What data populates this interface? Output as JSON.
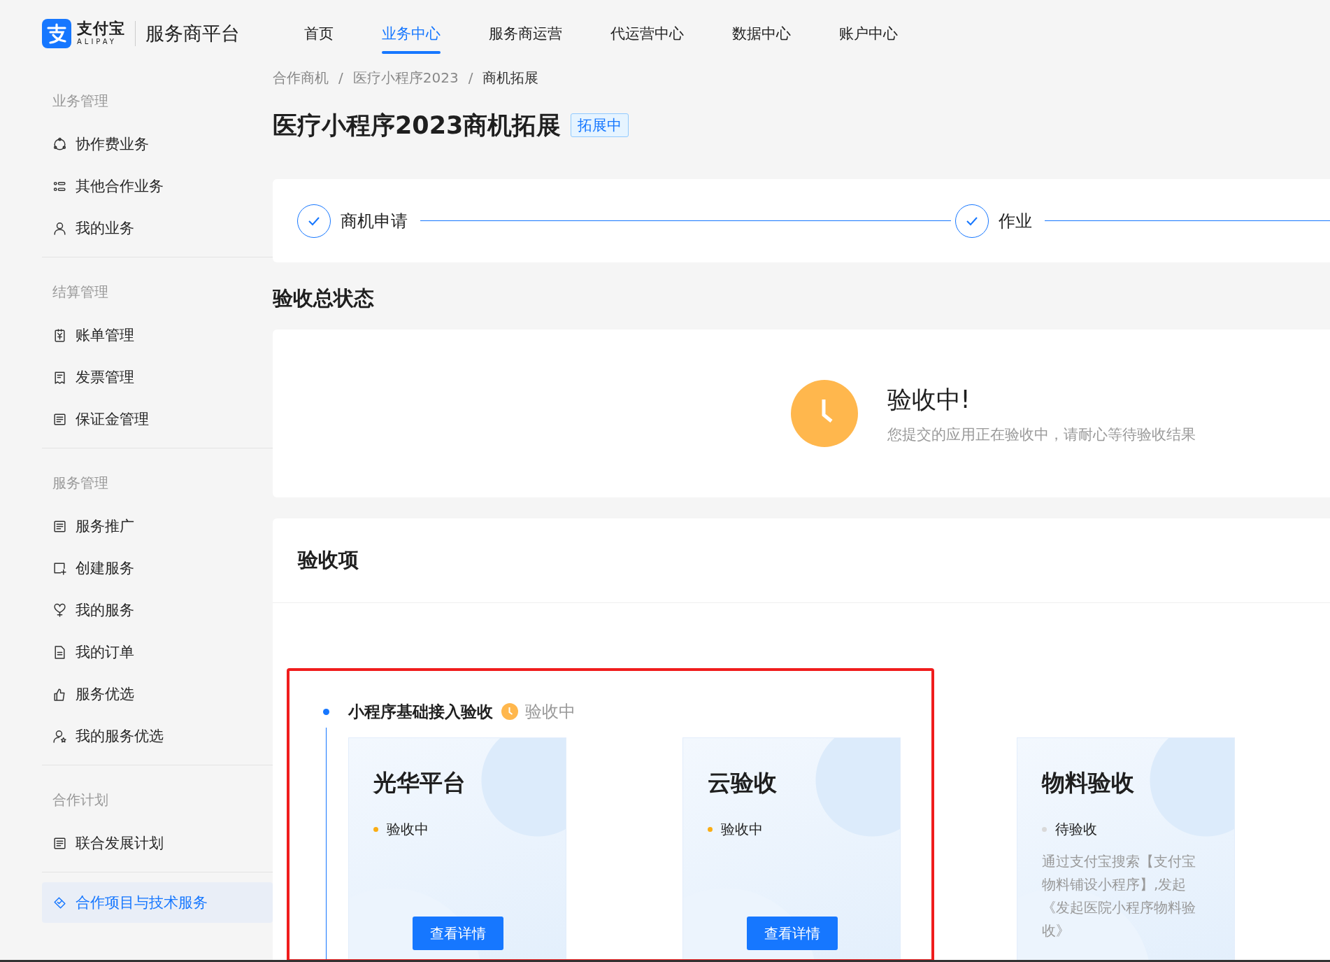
{
  "header": {
    "logo": {
      "brand": "支付宝",
      "brand_sub": "ALIPAY",
      "product": "服务商平台"
    },
    "nav": [
      {
        "label": "首页",
        "selected": false
      },
      {
        "label": "业务中心",
        "selected": true
      },
      {
        "label": "服务商运营",
        "selected": false
      },
      {
        "label": "代运营中心",
        "selected": false
      },
      {
        "label": "数据中心",
        "selected": false
      },
      {
        "label": "账户中心",
        "selected": false
      }
    ]
  },
  "sidebar": {
    "groups": [
      {
        "title": "业务管理",
        "items": [
          {
            "label": "协作费业务",
            "selected": false
          },
          {
            "label": "其他合作业务",
            "selected": false
          },
          {
            "label": "我的业务",
            "selected": false
          }
        ]
      },
      {
        "title": "结算管理",
        "items": [
          {
            "label": "账单管理",
            "selected": false
          },
          {
            "label": "发票管理",
            "selected": false
          },
          {
            "label": "保证金管理",
            "selected": false
          }
        ]
      },
      {
        "title": "服务管理",
        "items": [
          {
            "label": "服务推广",
            "selected": false
          },
          {
            "label": "创建服务",
            "selected": false
          },
          {
            "label": "我的服务",
            "selected": false
          },
          {
            "label": "我的订单",
            "selected": false
          },
          {
            "label": "服务优选",
            "selected": false
          },
          {
            "label": "我的服务优选",
            "selected": false
          }
        ]
      },
      {
        "title": "合作计划",
        "items": [
          {
            "label": "联合发展计划",
            "selected": false
          }
        ]
      },
      {
        "items": [
          {
            "label": "合作项目与技术服务",
            "selected": true
          }
        ]
      }
    ]
  },
  "breadcrumb": {
    "items": [
      "合作商机",
      "医疗小程序2023",
      "商机拓展"
    ],
    "separators": [
      "/",
      "/"
    ]
  },
  "page_title": "医疗小程序2023商机拓展",
  "status_tag": "拓展中",
  "steps": [
    {
      "label": "商机申请",
      "done": true
    },
    {
      "label": "作业",
      "done": true
    }
  ],
  "overall_title": "验收总状态",
  "overall_status": {
    "title": "验收中!",
    "description": "您提交的应用正在验收中，请耐心等待验收结果"
  },
  "acceptance": {
    "title": "验收项",
    "group": {
      "title": "小程序基础接入验收",
      "status": "验收中"
    },
    "cards": [
      {
        "title": "光华平台",
        "status": "验收中",
        "color": "#faad14",
        "button": "查看详情"
      },
      {
        "title": "云验收",
        "status": "验收中",
        "color": "#faad14",
        "button": "查看详情"
      },
      {
        "title": "物料验收",
        "status": "待验收",
        "color": "#d9d9d9",
        "description": "通过支付宝搜索【支付宝物料铺设小程序】,发起《发起医院小程序物料验收》"
      }
    ]
  }
}
